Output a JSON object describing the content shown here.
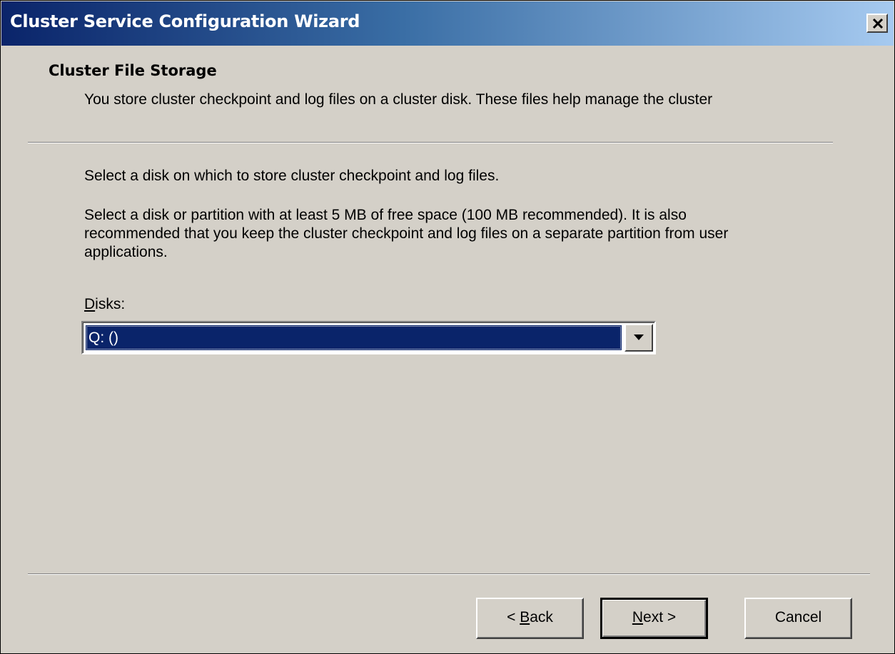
{
  "window": {
    "title": "Cluster Service Configuration Wizard",
    "close_icon": "close-icon"
  },
  "header": {
    "title": "Cluster File Storage",
    "description": "You store cluster checkpoint and log files on a cluster disk. These files help manage the cluster"
  },
  "body": {
    "instruction": "Select a disk on which to store cluster checkpoint and log files.",
    "recommendation": "Select a disk or partition with at least 5 MB of free space (100 MB recommended). It is also recommended that you keep the cluster checkpoint and log files on a separate partition from user applications.",
    "disks_label_mnemonic": "D",
    "disks_label_rest": "isks:",
    "disks_selected": "Q: ()"
  },
  "buttons": {
    "back_prefix": "< ",
    "back_mnemonic": "B",
    "back_rest": "ack",
    "next_mnemonic": "N",
    "next_rest": "ext >",
    "cancel": "Cancel"
  },
  "colors": {
    "title_gradient_start": "#0a246a",
    "title_gradient_end": "#a6caf0",
    "dialog_face": "#d4d0c8",
    "selection": "#0a246a"
  }
}
